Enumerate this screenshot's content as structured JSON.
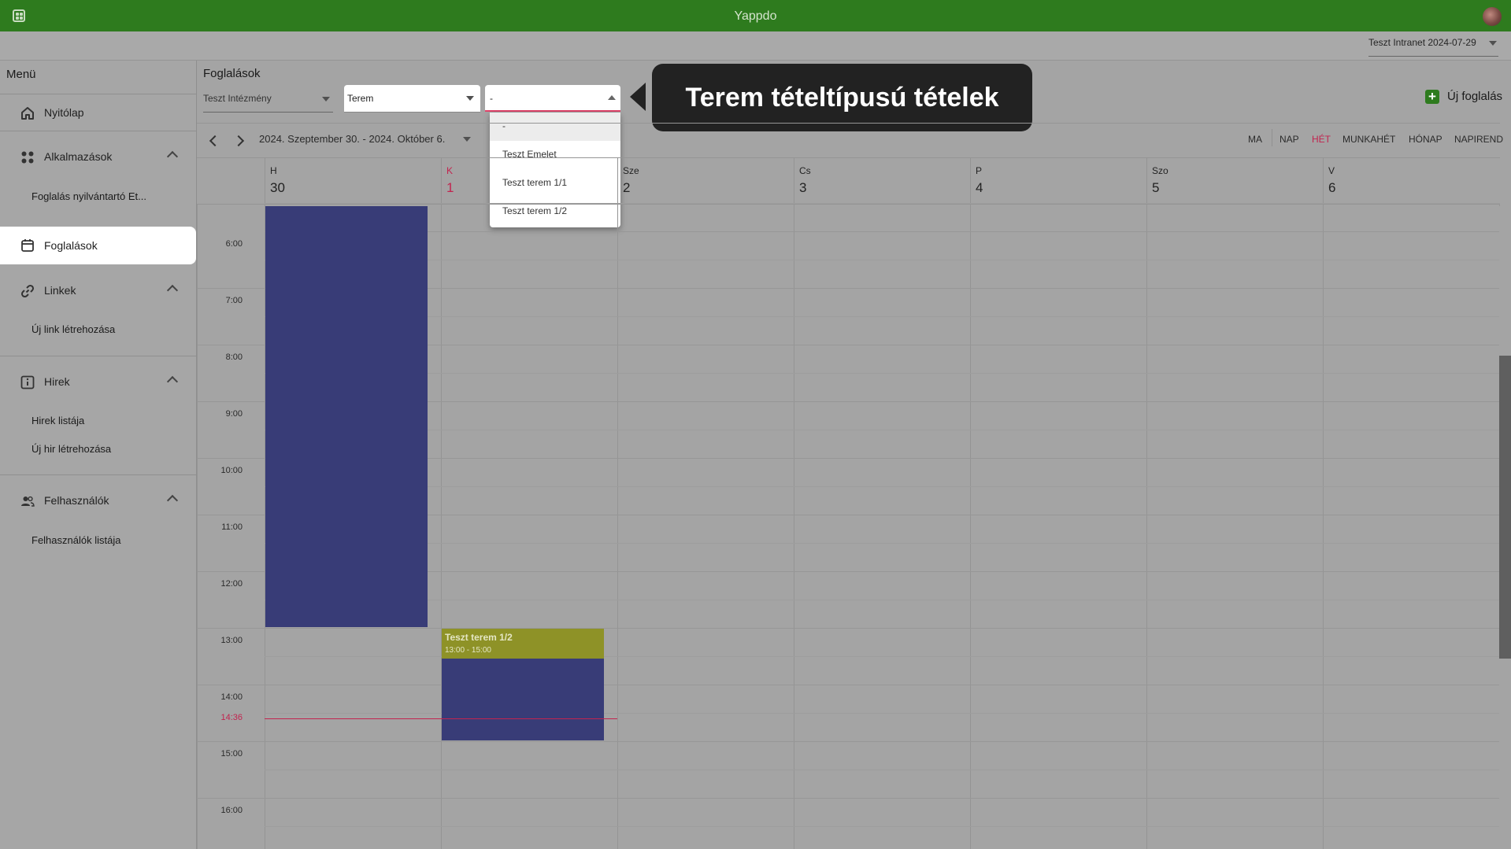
{
  "app": {
    "title": "Yappdo"
  },
  "intranet": {
    "label": "Teszt Intranet 2024-07-29"
  },
  "sidebar": {
    "title": "Menü",
    "home": "Nyitólap",
    "apps": {
      "label": "Alkalmazások",
      "sub": [
        "Foglalás nyilvántartó Et..."
      ]
    },
    "bookings": "Foglalások",
    "links": {
      "label": "Linkek",
      "sub": [
        "Új link létrehozása"
      ]
    },
    "news": {
      "label": "Hirek",
      "sub": [
        "Hirek listája",
        "Új hir létrehozása"
      ]
    },
    "users": {
      "label": "Felhasználók",
      "sub": [
        "Felhasználók listája"
      ]
    }
  },
  "main": {
    "title": "Foglalások",
    "institution": "Teszt Intézmény",
    "type": "Terem",
    "item": "-",
    "dropdown_options": [
      "-",
      "Teszt Emelet",
      "Teszt terem 1/1",
      "Teszt terem 1/2"
    ],
    "tooltip": "Terem tételtípusú tételek",
    "new_booking": "Új foglalás"
  },
  "toolbar": {
    "date_range": "2024. Szeptember 30. - 2024. Október 6.",
    "views": [
      "MA",
      "NAP",
      "HÉT",
      "MUNKAHÉT",
      "HÓNAP",
      "NAPIREND"
    ],
    "active_view": "HÉT"
  },
  "calendar": {
    "days": [
      {
        "name": "H",
        "num": "30"
      },
      {
        "name": "K",
        "num": "1"
      },
      {
        "name": "Sze",
        "num": "2"
      },
      {
        "name": "Cs",
        "num": "3"
      },
      {
        "name": "P",
        "num": "4"
      },
      {
        "name": "Szo",
        "num": "5"
      },
      {
        "name": "V",
        "num": "6"
      }
    ],
    "today_index": 1,
    "hours": [
      "6:00",
      "7:00",
      "8:00",
      "9:00",
      "10:00",
      "11:00",
      "12:00",
      "13:00",
      "14:00",
      "15:00",
      "16:00"
    ],
    "now_label": "14:36",
    "event": {
      "title": "Teszt terem 1/2",
      "time": "13:00 - 15:00"
    }
  },
  "colors": {
    "brand": "#2e7b1e",
    "accent": "#c2244f",
    "event_blue": "#383c77",
    "event_yellow": "#8e9227"
  }
}
